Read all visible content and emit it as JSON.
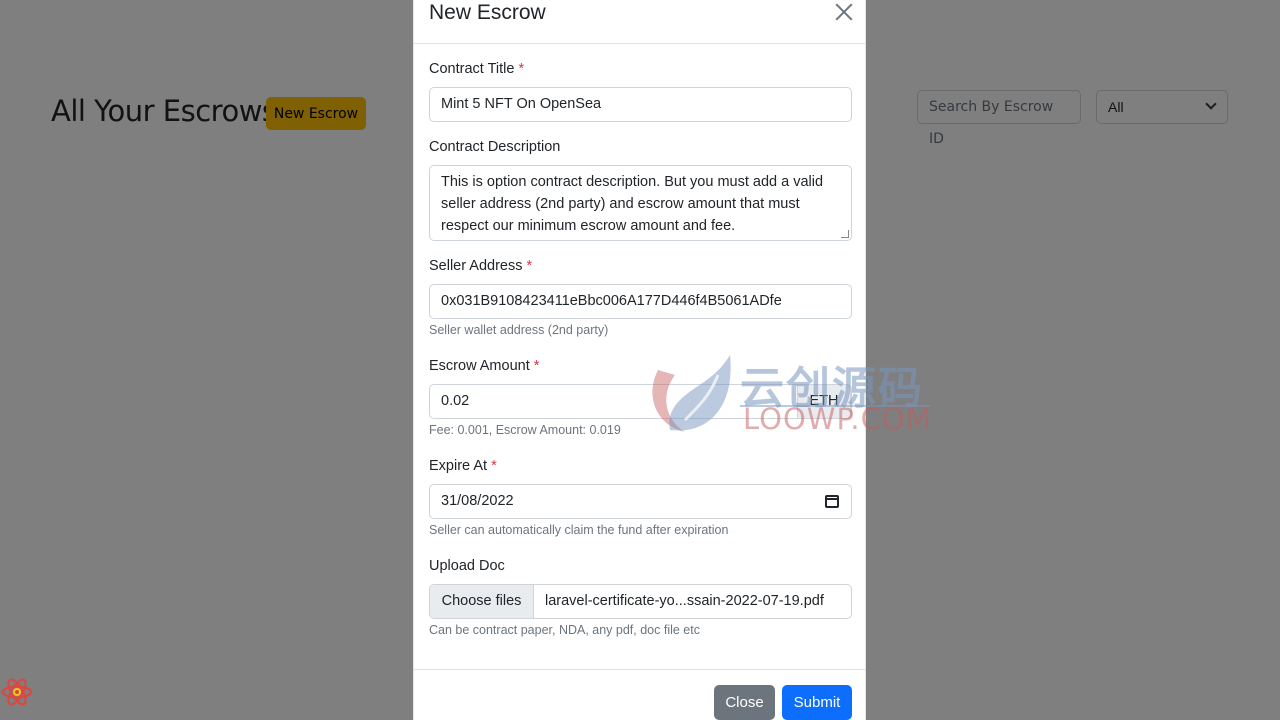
{
  "background": {
    "page_title": "All Your Escrows",
    "new_escrow_label": "New Escrow",
    "search_placeholder": "Search By Escrow ID",
    "filter_selected": "All"
  },
  "modal": {
    "title": "New Escrow",
    "fields": {
      "contract_title": {
        "label": "Contract Title",
        "required": "*",
        "value": "Mint 5 NFT On OpenSea"
      },
      "contract_description": {
        "label": "Contract Description",
        "value": "This is option contract description. But you must add a valid seller address (2nd party) and escrow amount that must respect our minimum escrow amount and fee."
      },
      "seller_address": {
        "label": "Seller Address",
        "required": "*",
        "value": "0x031B9108423411eBbc006A177D446f4B5061ADfe",
        "help": "Seller wallet address (2nd party)"
      },
      "escrow_amount": {
        "label": "Escrow Amount",
        "required": "*",
        "value": "0.02",
        "unit": "ETH",
        "help": "Fee: 0.001, Escrow Amount: 0.019"
      },
      "expire_at": {
        "label": "Expire At",
        "required": "*",
        "value": "31/08/2022",
        "help": "Seller can automatically claim the fund after expiration"
      },
      "upload_doc": {
        "label": "Upload Doc",
        "button_label": "Choose files",
        "file_name": "laravel-certificate-yo...ssain-2022-07-19.pdf",
        "help": "Can be contract paper, NDA, any pdf, doc file etc"
      }
    },
    "footer": {
      "close_label": "Close",
      "submit_label": "Submit"
    }
  },
  "watermark": {
    "cn_text": "云创源码",
    "en_text": "LOOWP.COM"
  },
  "colors": {
    "primary": "#0d6efd",
    "secondary": "#6c757d",
    "warning": "#ffc107",
    "danger": "#dc3545"
  }
}
